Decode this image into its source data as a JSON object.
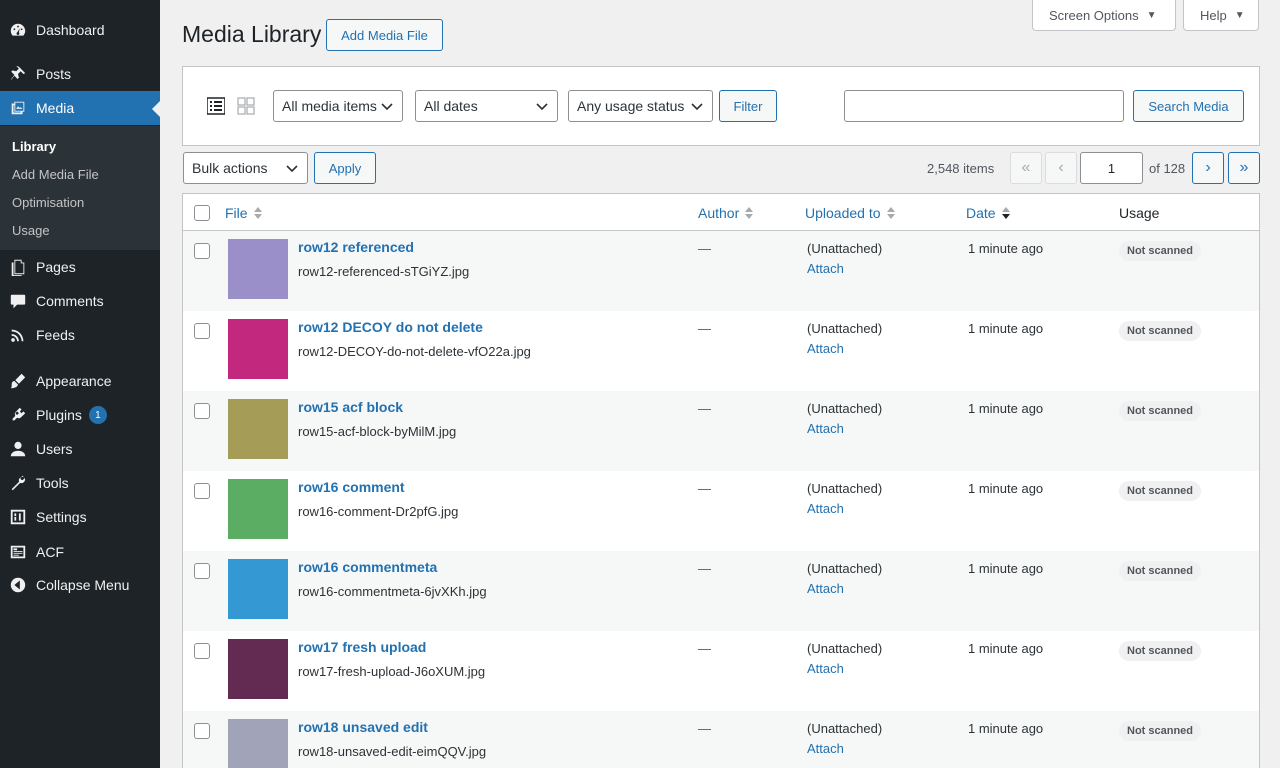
{
  "sidebar": {
    "items": [
      {
        "label": "Dashboard",
        "icon": "dashboard-icon"
      },
      {
        "label": "Posts",
        "icon": "pin-icon"
      },
      {
        "label": "Media",
        "icon": "media-icon"
      },
      {
        "label": "Pages",
        "icon": "pages-icon"
      },
      {
        "label": "Comments",
        "icon": "comment-icon"
      },
      {
        "label": "Feeds",
        "icon": "rss-icon"
      },
      {
        "label": "Appearance",
        "icon": "brush-icon"
      },
      {
        "label": "Plugins",
        "icon": "plug-icon",
        "badge": "1"
      },
      {
        "label": "Users",
        "icon": "user-icon"
      },
      {
        "label": "Tools",
        "icon": "wrench-icon"
      },
      {
        "label": "Settings",
        "icon": "settings-icon"
      },
      {
        "label": "ACF",
        "icon": "acf-icon"
      },
      {
        "label": "Collapse Menu",
        "icon": "collapse-icon"
      }
    ],
    "submenu": [
      "Library",
      "Add Media File",
      "Optimisation",
      "Usage"
    ]
  },
  "top_tabs": {
    "screen_options": "Screen Options",
    "help": "Help"
  },
  "header": {
    "title": "Media Library",
    "add_button": "Add Media File"
  },
  "filters": {
    "media_type": "All media items",
    "dates": "All dates",
    "usage_status": "Any usage status",
    "filter_button": "Filter",
    "search_value": "",
    "search_button": "Search Media"
  },
  "bulk": {
    "select": "Bulk actions",
    "apply": "Apply"
  },
  "pagination": {
    "items": "2,548 items",
    "current": "1",
    "of": "of 128",
    "first": "«",
    "prev": "‹",
    "next": "›",
    "last": "»"
  },
  "table": {
    "headers": {
      "file": "File",
      "author": "Author",
      "uploaded_to": "Uploaded to",
      "date": "Date",
      "usage": "Usage"
    },
    "rows": [
      {
        "title": "row12 referenced",
        "file": "row12-referenced-sTGiYZ.jpg",
        "color": "#9b8fc9",
        "author": "—",
        "uploaded": "(Unattached)",
        "attach": "Attach",
        "date": "1 minute ago",
        "usage": "Not scanned"
      },
      {
        "title": "row12 DECOY do not delete",
        "file": "row12-DECOY-do-not-delete-vfO22a.jpg",
        "color": "#c1287e",
        "author": "—",
        "uploaded": "(Unattached)",
        "attach": "Attach",
        "date": "1 minute ago",
        "usage": "Not scanned"
      },
      {
        "title": "row15 acf block",
        "file": "row15-acf-block-byMilM.jpg",
        "color": "#a59c58",
        "author": "—",
        "uploaded": "(Unattached)",
        "attach": "Attach",
        "date": "1 minute ago",
        "usage": "Not scanned"
      },
      {
        "title": "row16 comment",
        "file": "row16-comment-Dr2pfG.jpg",
        "color": "#5aad62",
        "author": "—",
        "uploaded": "(Unattached)",
        "attach": "Attach",
        "date": "1 minute ago",
        "usage": "Not scanned"
      },
      {
        "title": "row16 commentmeta",
        "file": "row16-commentmeta-6jvXKh.jpg",
        "color": "#3498d2",
        "author": "—",
        "uploaded": "(Unattached)",
        "attach": "Attach",
        "date": "1 minute ago",
        "usage": "Not scanned"
      },
      {
        "title": "row17 fresh upload",
        "file": "row17-fresh-upload-J6oXUM.jpg",
        "color": "#632b52",
        "author": "—",
        "uploaded": "(Unattached)",
        "attach": "Attach",
        "date": "1 minute ago",
        "usage": "Not scanned"
      },
      {
        "title": "row18 unsaved edit",
        "file": "row18-unsaved-edit-eimQQV.jpg",
        "color": "#a1a3b8",
        "author": "—",
        "uploaded": "(Unattached)",
        "attach": "Attach",
        "date": "1 minute ago",
        "usage": "Not scanned"
      }
    ]
  },
  "colors": {
    "accent": "#2271b1",
    "sidebar_bg": "#1d2327",
    "active_bg": "#2271b1"
  }
}
